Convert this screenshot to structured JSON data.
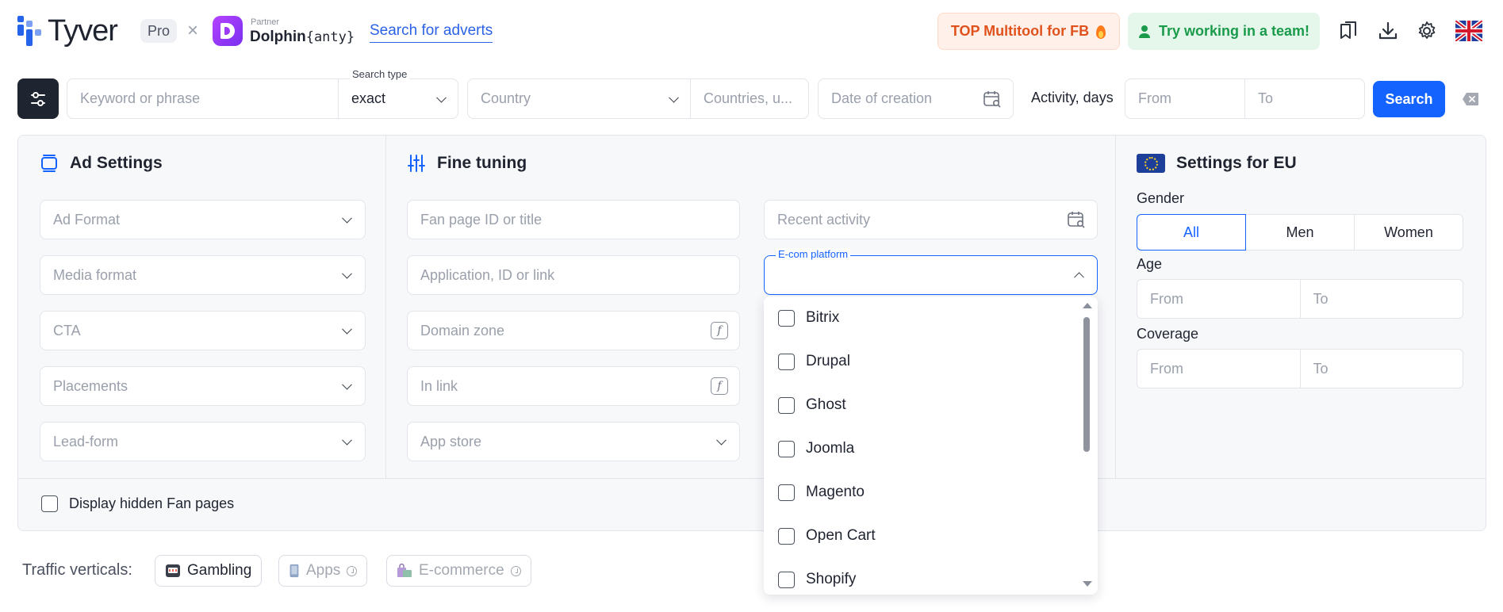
{
  "header": {
    "brand": "Tyver",
    "plan_badge": "Pro",
    "cross": "×",
    "partner_caption": "Partner",
    "partner_name_bold": "Dolphin",
    "partner_name_mono": "{anty}",
    "search_adverts_link": "Search for adverts",
    "top_multitool": "TOP Multitool for FB",
    "try_team": "Try working in a team!",
    "icons": [
      "bookmarks-icon",
      "download-icon",
      "gear-icon",
      "uk-flag-icon"
    ]
  },
  "search_bar": {
    "keyword_placeholder": "Keyword or phrase",
    "search_type_label": "Search type",
    "search_type_value": "exact",
    "country_placeholder": "Country",
    "countries_placeholder": "Countries, u...",
    "date_placeholder": "Date of creation",
    "activity_label": "Activity, days",
    "activity_from": "From",
    "activity_to": "To",
    "search_button": "Search"
  },
  "ad_settings": {
    "title": "Ad Settings",
    "fields": [
      "Ad Format",
      "Media format",
      "CTA",
      "Placements",
      "Lead-form"
    ]
  },
  "fine_tuning": {
    "title": "Fine tuning",
    "left_fields": [
      "Fan page ID or title",
      "Application, ID or link",
      "Domain zone",
      "In link",
      "App store"
    ],
    "recent_activity": "Recent activity",
    "ecom_label": "E-com platform",
    "ecom_options": [
      "Bitrix",
      "Drupal",
      "Ghost",
      "Joomla",
      "Magento",
      "Open Cart",
      "Shopify"
    ]
  },
  "eu_settings": {
    "title": "Settings for EU",
    "gender_label": "Gender",
    "gender_options": [
      "All",
      "Men",
      "Women"
    ],
    "age_label": "Age",
    "age_from": "From",
    "age_to": "To",
    "coverage_label": "Coverage",
    "coverage_from": "From",
    "coverage_to": "To"
  },
  "hidden_pages_label": "Display hidden Fan pages",
  "traffic_verticals": {
    "label": "Traffic verticals:",
    "chips": [
      "Gambling",
      "Apps",
      "E-commerce"
    ]
  },
  "colors": {
    "accent": "#1463ff",
    "link": "#2b62e6",
    "dark": "#1e2530",
    "multitool_text": "#e0521c",
    "team_text": "#1a9b4b"
  }
}
